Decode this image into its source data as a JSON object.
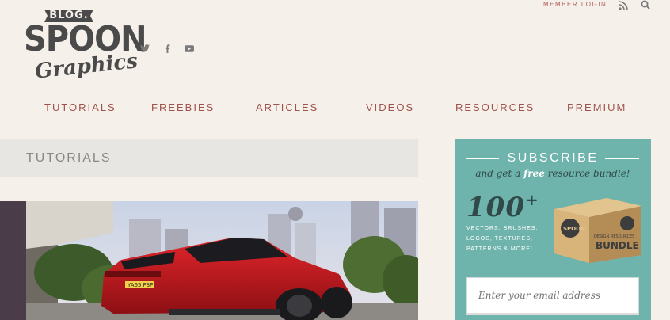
{
  "logo": {
    "badge": "BLOG.",
    "word": "SPOON",
    "script": "Graphics"
  },
  "social": [
    "twitter-icon",
    "facebook-icon",
    "youtube-icon"
  ],
  "topbar": {
    "member_login": "MEMBER LOGIN"
  },
  "nav": [
    "TUTORIALS",
    "FREEBIES",
    "ARTICLES",
    "VIDEOS",
    "RESOURCES",
    "PREMIUM"
  ],
  "section": {
    "title": "TUTORIALS"
  },
  "feature": {
    "plate": "YA65 FSP"
  },
  "subscribe": {
    "title": "SUBSCRIBE",
    "tagline_pre": "and get a ",
    "tagline_free": "free",
    "tagline_post": " resource bundle!",
    "count": "100",
    "count_suffix": "+",
    "assets_line1": "VECTORS, BRUSHES,",
    "assets_line2": "LOGOS, TEXTURES,",
    "assets_line3": "PATTERNS & MORE!",
    "bundle_brand": "SPOON",
    "bundle_label1": "DESIGN RESOURCES",
    "bundle_label2": "BUNDLE",
    "email_placeholder": "Enter your email address"
  },
  "colors": {
    "background": "#f5f0ea",
    "nav_text": "#a0524c",
    "subscribe_bg": "#6fb3ad",
    "dark_text": "#4a4a4a"
  }
}
